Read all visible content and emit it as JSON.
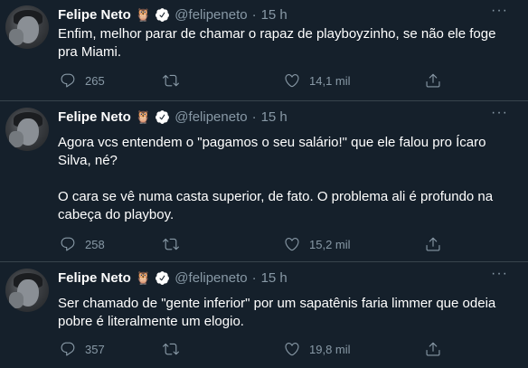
{
  "tweets": [
    {
      "author": "Felipe Neto",
      "handle": "@felipeneto",
      "time": "15 h",
      "paragraphs": [
        "Enfim, melhor parar de chamar o rapaz de playboyzinho, se não ele foge pra Miami."
      ],
      "replies": "265",
      "likes": "14,1 mil"
    },
    {
      "author": "Felipe Neto",
      "handle": "@felipeneto",
      "time": "15 h",
      "paragraphs": [
        "Agora vcs entendem o \"pagamos o seu salário!\" que ele falou pro Ícaro Silva, né?",
        "O cara se vê numa casta superior, de fato. O problema ali é profundo na cabeça do playboy."
      ],
      "replies": "258",
      "likes": "15,2 mil"
    },
    {
      "author": "Felipe Neto",
      "handle": "@felipeneto",
      "time": "15 h",
      "paragraphs": [
        "Ser chamado de \"gente inferior\" por um sapatênis faria limmer que odeia pobre é literalmente um elogio."
      ],
      "replies": "357",
      "likes": "19,8 mil"
    }
  ],
  "separator": "·",
  "more_glyph": "···",
  "owl_emoji": "🦉",
  "icons": {
    "avatar": "profile-photo",
    "badge": "verified-badge-icon",
    "reply": "reply-icon",
    "retweet": "retweet-icon",
    "like": "heart-icon",
    "share": "share-icon",
    "more": "more-icon"
  },
  "colors": {
    "background": "#15202b",
    "text": "#ffffff",
    "muted": "#8899a6",
    "divider": "#38444d",
    "verified": "#1da1f2"
  }
}
